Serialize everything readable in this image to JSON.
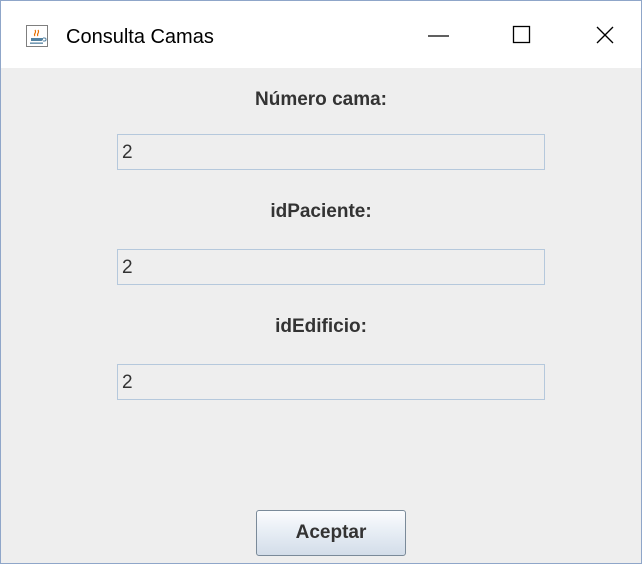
{
  "window": {
    "title": "Consulta Camas",
    "icon": "java-coffee-icon",
    "controls": [
      "minimize-icon",
      "maximize-icon",
      "close-icon"
    ]
  },
  "form": {
    "numero_cama": {
      "label": "Número cama:",
      "value": "2"
    },
    "id_paciente": {
      "label": "idPaciente:",
      "value": "2"
    },
    "id_edificio": {
      "label": "idEdificio:",
      "value": "2"
    }
  },
  "buttons": {
    "aceptar_label": "Aceptar"
  },
  "colors": {
    "titlebar_bg": "#ffffff",
    "content_bg": "#eeeeee",
    "field_border": "#b5c8dc",
    "text": "#333333"
  }
}
